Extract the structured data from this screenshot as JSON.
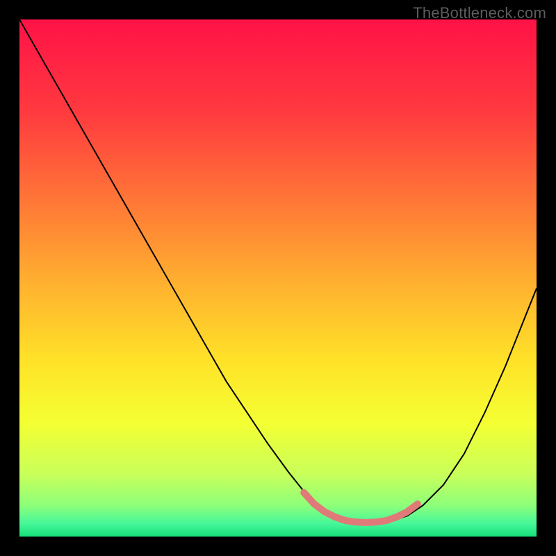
{
  "watermark": "TheBottleneck.com",
  "chart_data": {
    "type": "line",
    "title": "",
    "xlabel": "",
    "ylabel": "",
    "xlim": [
      0,
      100
    ],
    "ylim": [
      0,
      100
    ],
    "grid": false,
    "legend": false,
    "gradient_stops": [
      {
        "offset": 0.0,
        "color": "#ff1247"
      },
      {
        "offset": 0.18,
        "color": "#ff3a3f"
      },
      {
        "offset": 0.36,
        "color": "#ff7a36"
      },
      {
        "offset": 0.52,
        "color": "#ffb42f"
      },
      {
        "offset": 0.66,
        "color": "#ffe228"
      },
      {
        "offset": 0.78,
        "color": "#f4ff32"
      },
      {
        "offset": 0.88,
        "color": "#c8ff5a"
      },
      {
        "offset": 0.94,
        "color": "#8dff7a"
      },
      {
        "offset": 0.975,
        "color": "#46f79a"
      },
      {
        "offset": 1.0,
        "color": "#16e07a"
      }
    ],
    "series": [
      {
        "name": "curve",
        "color": "#000000",
        "stroke_width": 2,
        "x": [
          0.0,
          4.0,
          8.0,
          12.0,
          16.0,
          20.0,
          24.0,
          28.0,
          32.0,
          36.0,
          40.0,
          44.0,
          48.0,
          52.0,
          56.0,
          58.0,
          60.0,
          63.0,
          66.0,
          69.0,
          72.0,
          75.0,
          78.0,
          82.0,
          86.0,
          90.0,
          94.0,
          100.0
        ],
        "y": [
          100.0,
          93.0,
          86.0,
          79.0,
          72.0,
          65.0,
          58.0,
          51.0,
          44.0,
          37.0,
          30.0,
          24.0,
          18.0,
          12.5,
          7.5,
          5.5,
          4.0,
          3.0,
          2.7,
          2.7,
          3.0,
          4.0,
          6.0,
          10.0,
          16.0,
          24.0,
          33.0,
          48.0
        ]
      },
      {
        "name": "highlight",
        "color": "#e07a78",
        "stroke_width": 10,
        "linecap": "round",
        "x": [
          55.0,
          57.0,
          59.0,
          61.0,
          63.0,
          65.0,
          67.0,
          69.0,
          71.0,
          73.0,
          75.0,
          77.0
        ],
        "y": [
          8.5,
          6.3,
          4.8,
          3.8,
          3.1,
          2.8,
          2.7,
          2.8,
          3.1,
          3.8,
          4.8,
          6.3
        ]
      }
    ]
  }
}
